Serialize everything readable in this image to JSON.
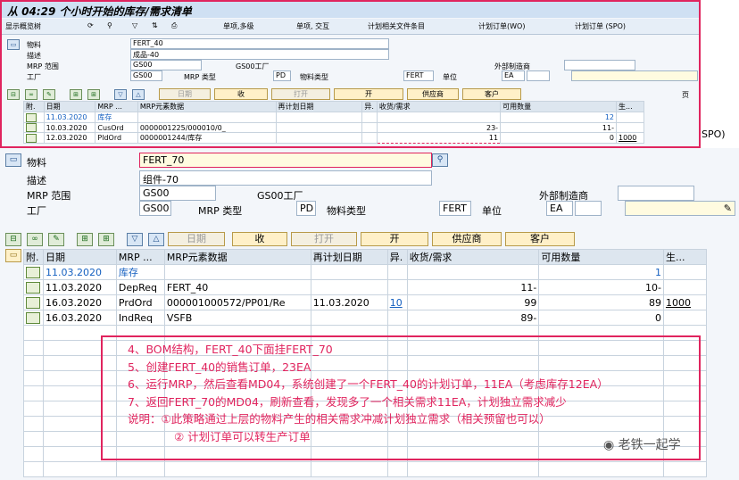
{
  "top": {
    "title": "从 04:29 个小时开始的库存/需求清单",
    "toolbar": [
      "显示概览树",
      "单项,多级",
      "单项, 交互",
      "计划相关文件条目",
      "计划订单(WO)",
      "计划订单 (SPO)"
    ],
    "material_label": "物料",
    "material_value": "FERT_40",
    "desc_label": "描述",
    "desc_value": "成品-40",
    "mrp_area_label": "MRP 范围",
    "mrp_area_value": "GS00",
    "mrp_area_plant": "GS00工厂",
    "ext_mfr_label": "外部制造商",
    "plant_label": "工厂",
    "plant_value": "GS00",
    "mrp_type_label": "MRP 类型",
    "mrp_type_value": "PD",
    "mat_type_label": "物料类型",
    "mat_type_value": "FERT",
    "unit_label": "单位",
    "unit_value": "EA",
    "buttons": [
      "日期",
      "收",
      "打开",
      "开",
      "供应商",
      "客户"
    ],
    "page_label": "页",
    "columns": [
      "附.",
      "日期",
      "MRP ...",
      "MRP元素数据",
      "再计划日期",
      "异.",
      "收货/需求",
      "可用数量",
      "生..."
    ],
    "rows": [
      {
        "date": "11.03.2020",
        "elem": "库存",
        "data": "",
        "resched": "",
        "exc": "",
        "qty": "",
        "avail": "12",
        "prod": "",
        "blue": true
      },
      {
        "date": "10.03.2020",
        "elem": "CusOrd",
        "data": "0000001225/000010/0_",
        "resched": "",
        "exc": "",
        "qty": "23-",
        "avail": "11-",
        "prod": "",
        "blue": false
      },
      {
        "date": "12.03.2020",
        "elem": "PldOrd",
        "data": "0000001244/库存",
        "resched": "",
        "exc": "",
        "qty": "11",
        "avail": "0",
        "prod": "1000",
        "blue": false
      }
    ],
    "side_text": "SPO)"
  },
  "bottom": {
    "material_label": "物料",
    "material_value": "FERT_70",
    "desc_label": "描述",
    "desc_value": "组件-70",
    "mrp_area_label": "MRP 范围",
    "mrp_area_value": "GS00",
    "mrp_area_plant": "GS00工厂",
    "ext_mfr_label": "外部制造商",
    "plant_label": "工厂",
    "plant_value": "GS00",
    "mrp_type_label": "MRP 类型",
    "mrp_type_value": "PD",
    "mat_type_label": "物料类型",
    "mat_type_value": "FERT",
    "unit_label": "单位",
    "unit_value": "EA",
    "buttons": [
      "日期",
      "收",
      "打开",
      "开",
      "供应商",
      "客户"
    ],
    "columns": [
      "附.",
      "日期",
      "MRP ...",
      "MRP元素数据",
      "再计划日期",
      "异.",
      "收货/需求",
      "可用数量",
      "生..."
    ],
    "rows": [
      {
        "date": "11.03.2020",
        "elem": "库存",
        "data": "",
        "resched": "",
        "exc": "",
        "qty": "",
        "avail": "1",
        "prod": "",
        "blue": true
      },
      {
        "date": "11.03.2020",
        "elem": "DepReq",
        "data": "FERT_40",
        "resched": "",
        "exc": "",
        "qty": "11-",
        "avail": "10-",
        "prod": "",
        "blue": false
      },
      {
        "date": "16.03.2020",
        "elem": "PrdOrd",
        "data": "000001000572/PP01/Re",
        "resched": "11.03.2020",
        "exc": "10",
        "qty": "99",
        "avail": "89",
        "prod": "1000",
        "blue": false
      },
      {
        "date": "16.03.2020",
        "elem": "IndReq",
        "data": "VSFB",
        "resched": "",
        "exc": "",
        "qty": "89-",
        "avail": "0",
        "prod": "",
        "blue": false
      }
    ]
  },
  "notes": [
    "4、BOM结构，FERT_40下面挂FERT_70",
    "5、创建FERT_40的销售订单，23EA",
    "6、运行MRP，然后查看MD04，系统创建了一个FERT_40的计划订单，11EA（考虑库存12EA）",
    "7、返回FERT_70的MD04，刷新查看，发现多了一个相关需求11EA，计划独立需求减少",
    "说明：①此策略通过上层的物料产生的相关需求冲减计划独立需求（相关预留也可以）",
    "② 计划订单可以转生产订单"
  ],
  "watermark": "老铁一起学"
}
